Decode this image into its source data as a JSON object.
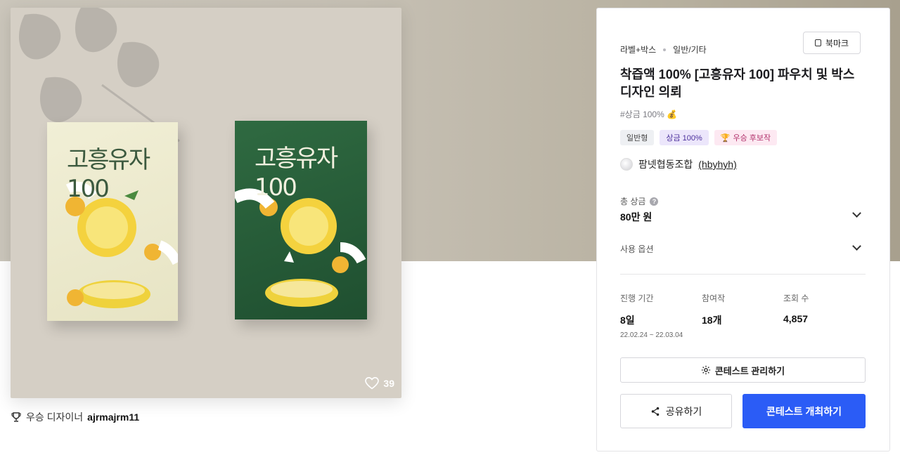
{
  "gallery": {
    "like_count": "39"
  },
  "winner": {
    "prefix": "우승 디자이너",
    "name": "ajrmajrm11"
  },
  "panel": {
    "category": "라벨+박스",
    "subcategory": "일반/기타",
    "bookmark_label": "북마크",
    "title": "착즙액 100% [고흥유자 100] 파우치 및 박스 디자인 의뢰",
    "tagline": "#상금 100% 💰",
    "badges": [
      "일반형",
      "상금 100%",
      "우승 후보작"
    ],
    "host_name": "팜넷협동조합",
    "host_id": "(hbyhyh)",
    "prize_label": "총 상금",
    "prize_value": "80만 원",
    "usage_label": "사용 옵션",
    "stats": {
      "period_label": "진행 기간",
      "period_value": "8일",
      "period_dates": "22.02.24 ~ 22.03.04",
      "entries_label": "참여작",
      "entries_value": "18개",
      "views_label": "조회 수",
      "views_value": "4,857"
    },
    "manage_button": "콘테스트 관리하기",
    "share_button": "공유하기",
    "host_button": "콘테스트 개최하기"
  },
  "colors": {
    "primary": "#2b5cf6",
    "badge_purple": "#ece6fb",
    "badge_pink": "#fde9f2"
  },
  "icons": [
    "bookmark-icon",
    "help-icon",
    "chevron-down-icon",
    "gear-icon",
    "share-icon",
    "heart-icon",
    "trophy-icon"
  ]
}
